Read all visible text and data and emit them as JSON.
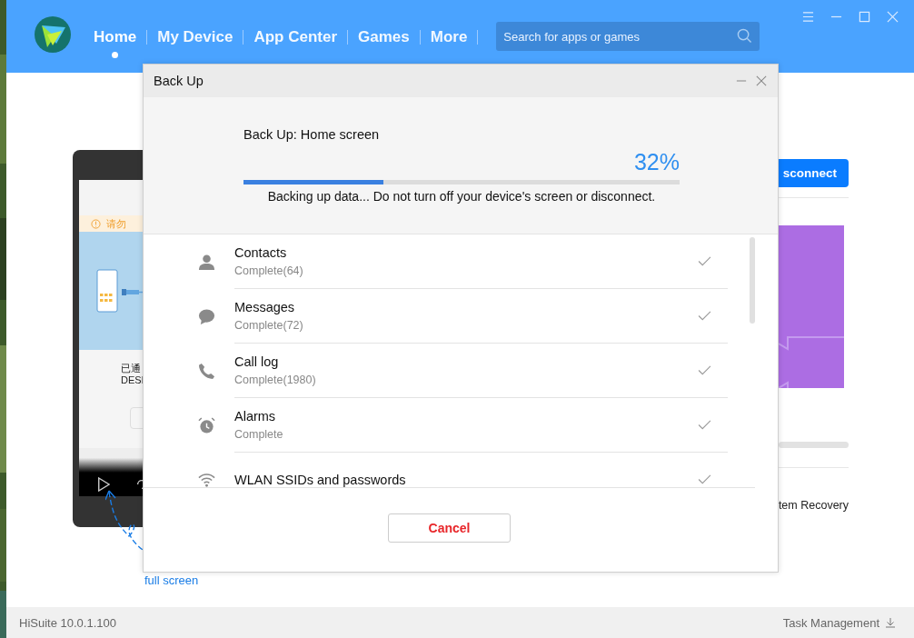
{
  "nav": {
    "tabs": [
      {
        "label": "Home",
        "selected": true
      },
      {
        "label": "My Device",
        "selected": false
      },
      {
        "label": "App Center",
        "selected": false
      },
      {
        "label": "Games",
        "selected": false
      },
      {
        "label": "More",
        "selected": false
      }
    ]
  },
  "search": {
    "placeholder": "Search for apps or games"
  },
  "background": {
    "phone": {
      "banner": "请勿",
      "caption_lines": [
        "已通",
        "DESI"
      ]
    },
    "disconnect_button": "sconnect",
    "recovery_link": "tem Recovery",
    "hint": "full screen"
  },
  "dialog": {
    "title": "Back Up",
    "heading": "Back Up: Home screen",
    "percent": "32%",
    "level": 0.32,
    "message": "Backing up data... Do not turn off your device's screen or disconnect.",
    "items": [
      {
        "kind": "contacts",
        "title": "Contacts",
        "status": "Complete(64)",
        "done": true
      },
      {
        "kind": "messages",
        "title": "Messages",
        "status": "Complete(72)",
        "done": true
      },
      {
        "kind": "calls",
        "title": "Call log",
        "status": "Complete(1980)",
        "done": true
      },
      {
        "kind": "alarms",
        "title": "Alarms",
        "status": "Complete",
        "done": true
      },
      {
        "kind": "wlan",
        "title": "WLAN SSIDs and passwords",
        "done": true
      }
    ],
    "cancel": "Cancel"
  },
  "status_bar": {
    "version": "HiSuite 10.0.1.100",
    "task": "Task Management"
  }
}
